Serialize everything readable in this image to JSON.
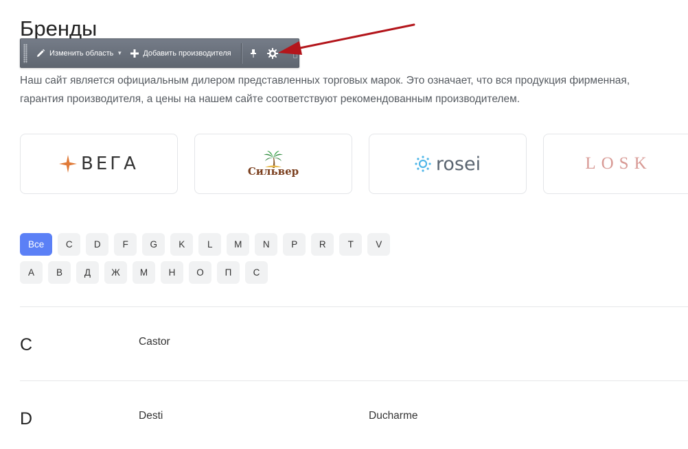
{
  "page": {
    "title": "Бренды",
    "intro_line1": "Наш сайт является официальным дилером представленных торговых марок. Это означает, что вся продукция фирменная,",
    "intro_line2": "гарантия производителя, а цены на нашем сайте соответствуют рекомендованным производителем."
  },
  "toolbar": {
    "edit_area_label": "Изменить область",
    "add_manufacturer_label": "Добавить производителя",
    "icons": [
      "pencil-icon",
      "plus-icon",
      "chevron-down-icon",
      "pin-icon",
      "gear-icon"
    ]
  },
  "brands": [
    {
      "logo_text": "ВЕГА",
      "accent": "#e07b39"
    },
    {
      "logo_text": "Сильвер",
      "accent": "#7a3e1d"
    },
    {
      "logo_text": "rosei",
      "accent": "#4fb6e8"
    },
    {
      "logo_text": "LOSK",
      "accent": "#d89a95"
    }
  ],
  "filters": {
    "latin": [
      "Все",
      "C",
      "D",
      "F",
      "G",
      "K",
      "L",
      "M",
      "N",
      "P",
      "R",
      "T",
      "V"
    ],
    "cyrillic": [
      "А",
      "В",
      "Д",
      "Ж",
      "М",
      "Н",
      "О",
      "П",
      "С"
    ],
    "active_color": "#5b80f6"
  },
  "sections": [
    {
      "letter": "C",
      "brands": [
        "Castor"
      ]
    },
    {
      "letter": "D",
      "brands": [
        "Desti",
        "Ducharme"
      ]
    }
  ]
}
